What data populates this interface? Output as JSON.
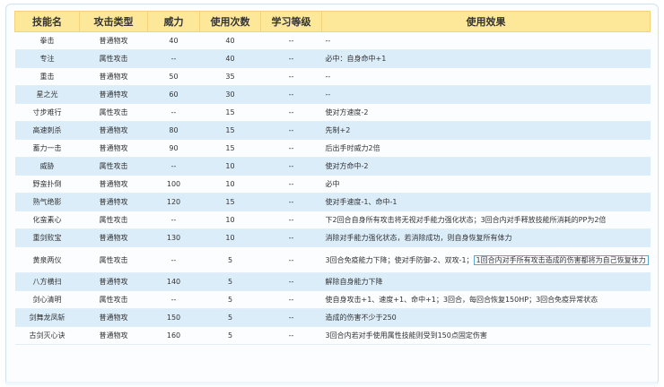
{
  "headers": [
    "技能名",
    "攻击类型",
    "威力",
    "使用次数",
    "学习等级",
    "使用效果"
  ],
  "rows": [
    {
      "name": "拳击",
      "type": "普通物攻",
      "power": "40",
      "pp": "40",
      "level": "--",
      "effect": "--"
    },
    {
      "name": "专注",
      "type": "属性攻击",
      "power": "--",
      "pp": "40",
      "level": "--",
      "effect": "必中：自身命中+1"
    },
    {
      "name": "重击",
      "type": "普通物攻",
      "power": "50",
      "pp": "35",
      "level": "--",
      "effect": "--"
    },
    {
      "name": "星之光",
      "type": "普通特攻",
      "power": "60",
      "pp": "30",
      "level": "--",
      "effect": "--"
    },
    {
      "name": "寸步难行",
      "type": "属性攻击",
      "power": "--",
      "pp": "15",
      "level": "--",
      "effect": "使对方速度-2"
    },
    {
      "name": "高速刺杀",
      "type": "普通物攻",
      "power": "80",
      "pp": "15",
      "level": "--",
      "effect": "先制+2"
    },
    {
      "name": "蓄力一击",
      "type": "普通物攻",
      "power": "90",
      "pp": "15",
      "level": "--",
      "effect": "后出手时威力2倍"
    },
    {
      "name": "威胁",
      "type": "属性攻击",
      "power": "--",
      "pp": "10",
      "level": "--",
      "effect": "使对方命中-2"
    },
    {
      "name": "野蛮扑倒",
      "type": "普通物攻",
      "power": "100",
      "pp": "10",
      "level": "--",
      "effect": "必中"
    },
    {
      "name": "熟气绝影",
      "type": "普通特攻",
      "power": "120",
      "pp": "15",
      "level": "--",
      "effect": "使对手速度-1、命中-1"
    },
    {
      "name": "化蛮素心",
      "type": "属性攻击",
      "power": "--",
      "pp": "10",
      "level": "--",
      "effect": "下2回合自身所有攻击将无视对手能力强化状态；3回合内对手释放技能所消耗的PP为2倍"
    },
    {
      "name": "重剑败宝",
      "type": "普通物攻",
      "power": "130",
      "pp": "10",
      "level": "--",
      "effect": "消除对手能力强化状态，若消除成功，则自身恢复所有体力"
    },
    {
      "name": "黄泉两仪",
      "type": "属性攻击",
      "power": "--",
      "pp": "5",
      "level": "--",
      "effect_main": "3回合免疫能力下降；使对手防御-2、双攻-1；",
      "effect_tip": "1回合内对手所有攻击造成的伤害都将为自己恢复体力"
    },
    {
      "name": "八方横扫",
      "type": "普通特攻",
      "power": "140",
      "pp": "5",
      "level": "--",
      "effect": "解除自身能力下降"
    },
    {
      "name": "剑心清明",
      "type": "属性攻击",
      "power": "--",
      "pp": "5",
      "level": "--",
      "effect": "使自身攻击+1、速度+1、命中+1；3回合，每回合恢复150HP；3回合免疫异常状态"
    },
    {
      "name": "剑舞龙凤斩",
      "type": "普通物攻",
      "power": "150",
      "pp": "5",
      "level": "--",
      "effect": "造成的伤害不少于250"
    },
    {
      "name": "古剑灭心诀",
      "type": "普通物攻",
      "power": "160",
      "pp": "5",
      "level": "--",
      "effect": "3回合内若对手使用属性技能则受到150点固定伤害"
    }
  ]
}
